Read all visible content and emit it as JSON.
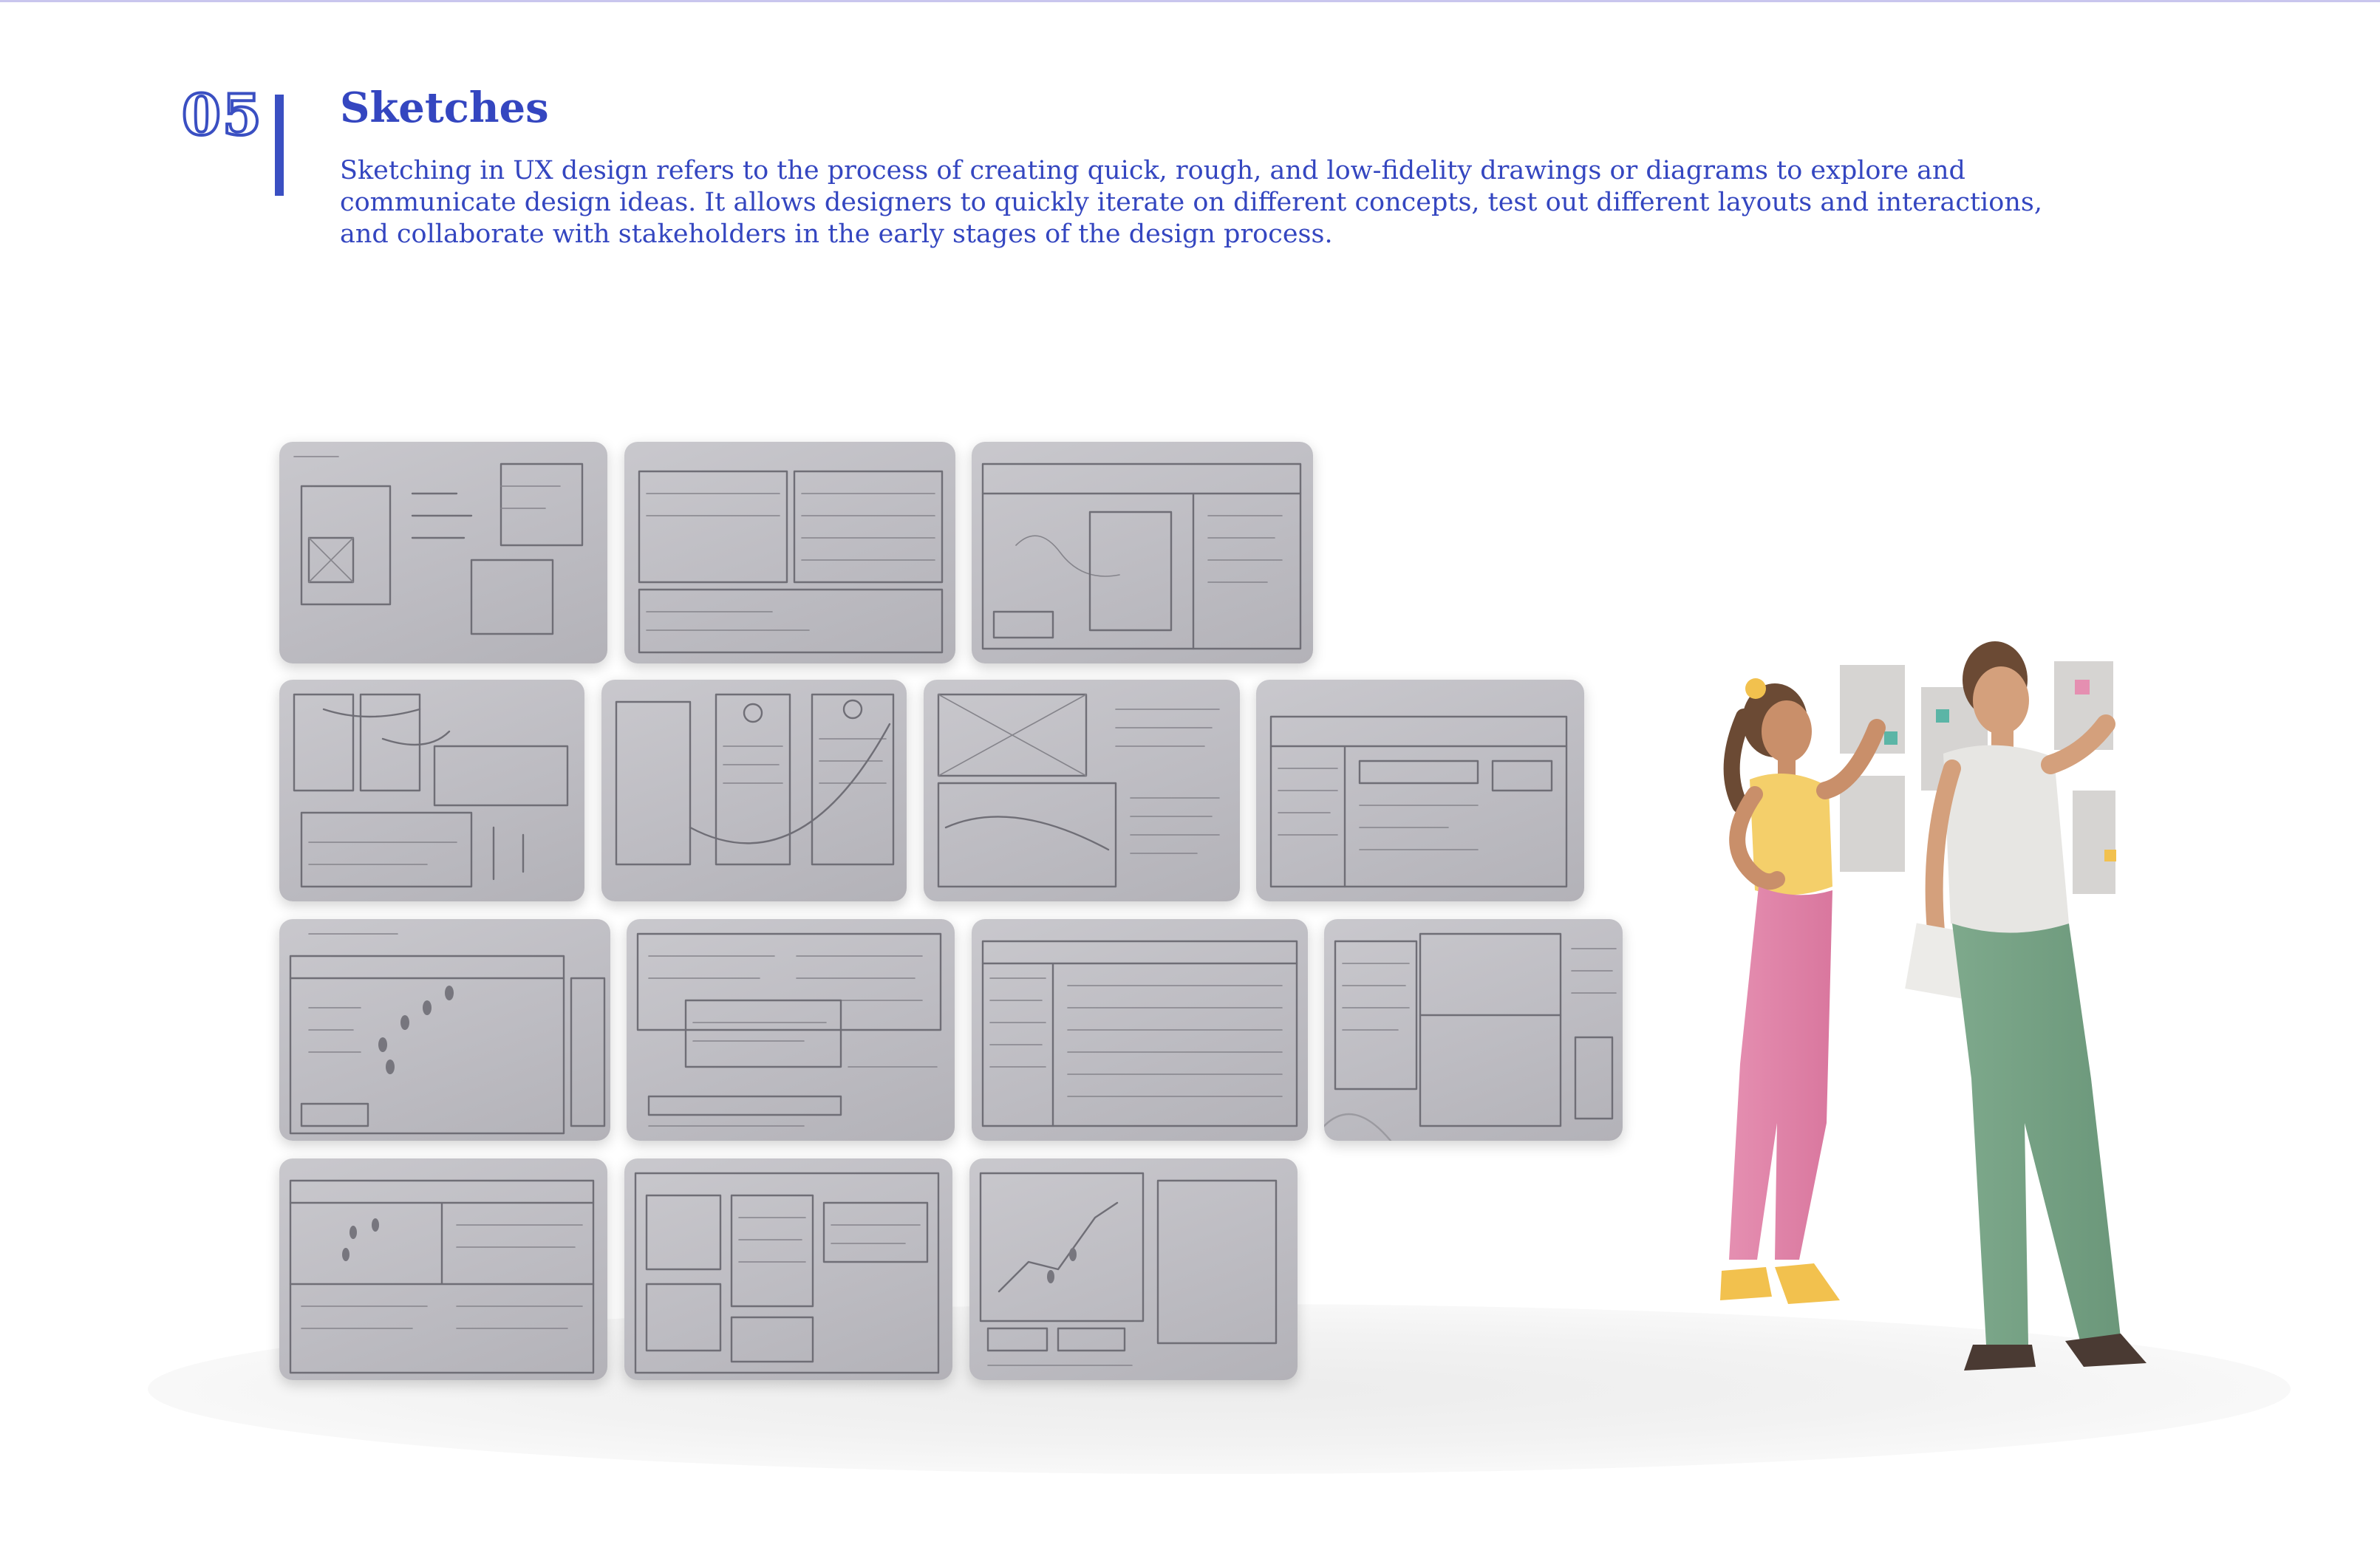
{
  "section": {
    "number": "05",
    "title": "Sketches",
    "description": "Sketching in UX design refers to the process of creating quick, rough, and low-fidelity drawings or diagrams to explore and communicate design ideas. It allows designers to quickly iterate on different concepts, test out different layouts and interactions, and collaborate with stakeholders in the early stages of the design process."
  },
  "colors": {
    "accent": "#3a4fc2",
    "text": "#3446c0",
    "sketch_paper": "#c4c3c9",
    "pencil": "#6f6e76"
  },
  "gallery": {
    "rows": 4,
    "photo_count": 14,
    "subject": "hand-drawn wireframe sketch photos"
  },
  "illustration": {
    "subject": "two people arranging sticky notes on a wall"
  }
}
